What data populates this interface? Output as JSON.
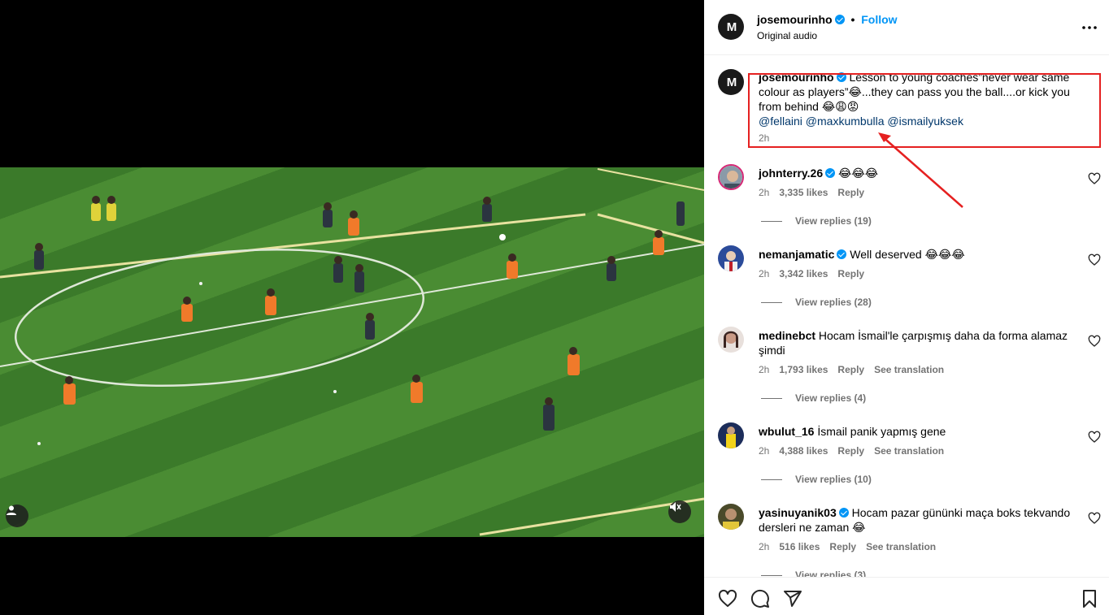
{
  "post": {
    "username": "josemourinho",
    "follow_label": "Follow",
    "separator": "•",
    "audio": "Original audio",
    "avatar_initials": "M",
    "caption_user": "josemourinho",
    "caption_text": "Lesson to young coaches”never wear same colour as players”😂...they can pass you the ball....or kick you from behind 😂😩😡",
    "mentions": [
      "@fellaini",
      "@maxkumbulla",
      "@ismailyuksek"
    ],
    "caption_time": "2h"
  },
  "comments": [
    {
      "username": "johnterry.26",
      "verified": true,
      "text": "😂😂😂",
      "time": "2h",
      "likes": "3,335 likes",
      "reply": "Reply",
      "translation": "",
      "replies": "View replies (19)",
      "avatar_color": "#8a9aa8"
    },
    {
      "username": "nemanjamatic",
      "verified": true,
      "text": "Well deserved 😂😂😂",
      "time": "2h",
      "likes": "3,342 likes",
      "reply": "Reply",
      "translation": "",
      "replies": "View replies (28)",
      "avatar_color": "#2b4b9a"
    },
    {
      "username": "medinebct",
      "verified": false,
      "text": "Hocam İsmail'le çarpışmış daha da forma alamaz şimdi",
      "time": "2h",
      "likes": "1,793 likes",
      "reply": "Reply",
      "translation": "See translation",
      "replies": "View replies (4)",
      "avatar_color": "#c99a86"
    },
    {
      "username": "wbulut_16",
      "verified": false,
      "text": "İsmail panik yapmış gene",
      "time": "2h",
      "likes": "4,388 likes",
      "reply": "Reply",
      "translation": "See translation",
      "replies": "View replies (10)",
      "avatar_color": "#1c2d5a"
    },
    {
      "username": "yasinuyanik03",
      "verified": true,
      "text": "Hocam pazar gününki maça boks tekvando dersleri ne zaman 😂",
      "time": "2h",
      "likes": "516 likes",
      "reply": "Reply",
      "translation": "See translation",
      "replies": "View replies (3)",
      "avatar_color": "#3a3a2a"
    }
  ],
  "icons": {
    "more": "more-options-icon",
    "like": "heart-icon",
    "comment": "comment-icon",
    "share": "share-icon",
    "save": "bookmark-icon",
    "mute": "muted-speaker-icon",
    "tag": "user-tag-icon"
  },
  "colors": {
    "accent": "#0095f6",
    "highlight_box": "#e52020",
    "mention": "#00376b",
    "muted_text": "#737373"
  }
}
